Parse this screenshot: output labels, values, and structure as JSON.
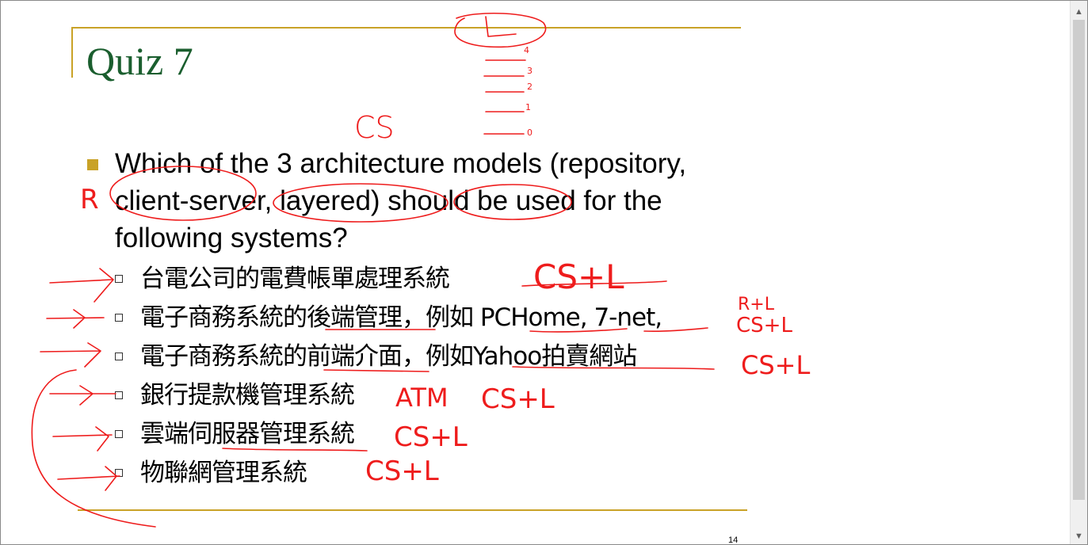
{
  "slide": {
    "title": "Quiz 7",
    "question": "Which of the 3 architecture models (repository, client-server, layered) should be used for the following systems?",
    "items": [
      "台電公司的電費帳單處理系統",
      "電子商務系統的後端管理，例如 PCHome, 7-net,",
      "電子商務系統的前端介面，例如Yahoo拍賣網站",
      "銀行提款機管理系統",
      "雲端伺服器管理系統",
      "物聯網管理系統"
    ],
    "page_number": "14"
  },
  "annotations": {
    "cs": "CS",
    "r": "R",
    "atm": "ATM",
    "answers": [
      "CS+L",
      "R+L",
      "CS+L",
      "CS+L",
      "CS+L",
      "CS+L",
      "CS+L"
    ],
    "stack_numbers": [
      "4",
      "3",
      "2",
      "1",
      "0"
    ]
  },
  "scrollbar": {
    "up_icon": "▲",
    "down_icon": "▼"
  },
  "colors": {
    "title": "#1a5e2e",
    "rule": "#c9a227",
    "ink": "#ee1c1c"
  }
}
